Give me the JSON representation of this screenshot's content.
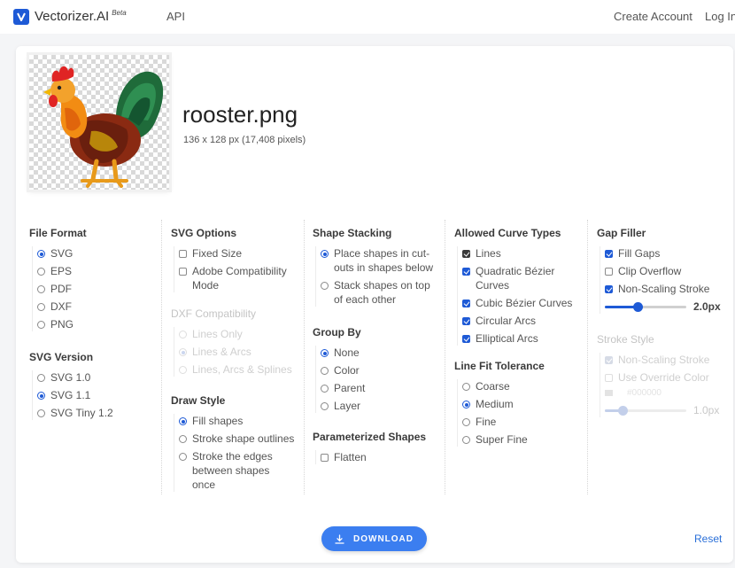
{
  "header": {
    "brand": "Vectorizer.AI",
    "brand_badge": "Beta",
    "nav_api": "API",
    "create_account": "Create Account",
    "login": "Log In"
  },
  "file": {
    "name": "rooster.png",
    "meta": "136 x 128 px (17,408 pixels)"
  },
  "options": {
    "file_format": {
      "title": "File Format",
      "items": [
        {
          "label": "SVG",
          "selected": true
        },
        {
          "label": "EPS",
          "selected": false
        },
        {
          "label": "PDF",
          "selected": false
        },
        {
          "label": "DXF",
          "selected": false
        },
        {
          "label": "PNG",
          "selected": false
        }
      ]
    },
    "svg_version": {
      "title": "SVG Version",
      "items": [
        {
          "label": "SVG 1.0",
          "selected": false
        },
        {
          "label": "SVG 1.1",
          "selected": true
        },
        {
          "label": "SVG Tiny 1.2",
          "selected": false
        }
      ]
    },
    "svg_options": {
      "title": "SVG Options",
      "items": [
        {
          "label": "Fixed Size",
          "checked": false
        },
        {
          "label": "Adobe Compatibility Mode",
          "checked": false
        }
      ]
    },
    "dxf_compat": {
      "title": "DXF Compatibility",
      "items": [
        {
          "label": "Lines Only",
          "selected": false
        },
        {
          "label": "Lines & Arcs",
          "selected": true
        },
        {
          "label": "Lines, Arcs & Splines",
          "selected": false
        }
      ]
    },
    "draw_style": {
      "title": "Draw Style",
      "items": [
        {
          "label": "Fill shapes",
          "selected": true
        },
        {
          "label": "Stroke shape outlines",
          "selected": false
        },
        {
          "label": "Stroke the edges between shapes once",
          "selected": false
        }
      ]
    },
    "shape_stacking": {
      "title": "Shape Stacking",
      "items": [
        {
          "label": "Place shapes in cut-outs in shapes below",
          "selected": true
        },
        {
          "label": "Stack shapes on top of each other",
          "selected": false
        }
      ]
    },
    "group_by": {
      "title": "Group By",
      "items": [
        {
          "label": "None",
          "selected": true
        },
        {
          "label": "Color",
          "selected": false
        },
        {
          "label": "Parent",
          "selected": false
        },
        {
          "label": "Layer",
          "selected": false
        }
      ]
    },
    "parameterized": {
      "title": "Parameterized Shapes",
      "items": [
        {
          "label": "Flatten",
          "checked": false
        }
      ]
    },
    "curve_types": {
      "title": "Allowed Curve Types",
      "items": [
        {
          "label": "Lines",
          "checked": true
        },
        {
          "label": "Quadratic Bézier Curves",
          "checked": true
        },
        {
          "label": "Cubic Bézier Curves",
          "checked": true
        },
        {
          "label": "Circular Arcs",
          "checked": true
        },
        {
          "label": "Elliptical Arcs",
          "checked": true
        }
      ]
    },
    "line_fit": {
      "title": "Line Fit Tolerance",
      "items": [
        {
          "label": "Coarse",
          "selected": false
        },
        {
          "label": "Medium",
          "selected": true
        },
        {
          "label": "Fine",
          "selected": false
        },
        {
          "label": "Super Fine",
          "selected": false
        }
      ]
    },
    "gap_filler": {
      "title": "Gap Filler",
      "items": [
        {
          "label": "Fill Gaps",
          "checked": true
        },
        {
          "label": "Clip Overflow",
          "checked": false
        },
        {
          "label": "Non-Scaling Stroke",
          "checked": true
        }
      ],
      "slider_value": "2.0px",
      "slider_fraction": 0.4
    },
    "stroke_style": {
      "title": "Stroke Style",
      "items": [
        {
          "label": "Non-Scaling Stroke",
          "checked": true
        },
        {
          "label": "Use Override Color",
          "checked": false
        }
      ],
      "color_value": "#000000",
      "slider_value": "1.0px",
      "slider_fraction": 0.22
    }
  },
  "footer": {
    "download": "DOWNLOAD",
    "reset": "Reset"
  },
  "colors": {
    "accent": "#1e5ad6",
    "download_button": "#3b7ef0",
    "link": "#2a6fd8"
  }
}
